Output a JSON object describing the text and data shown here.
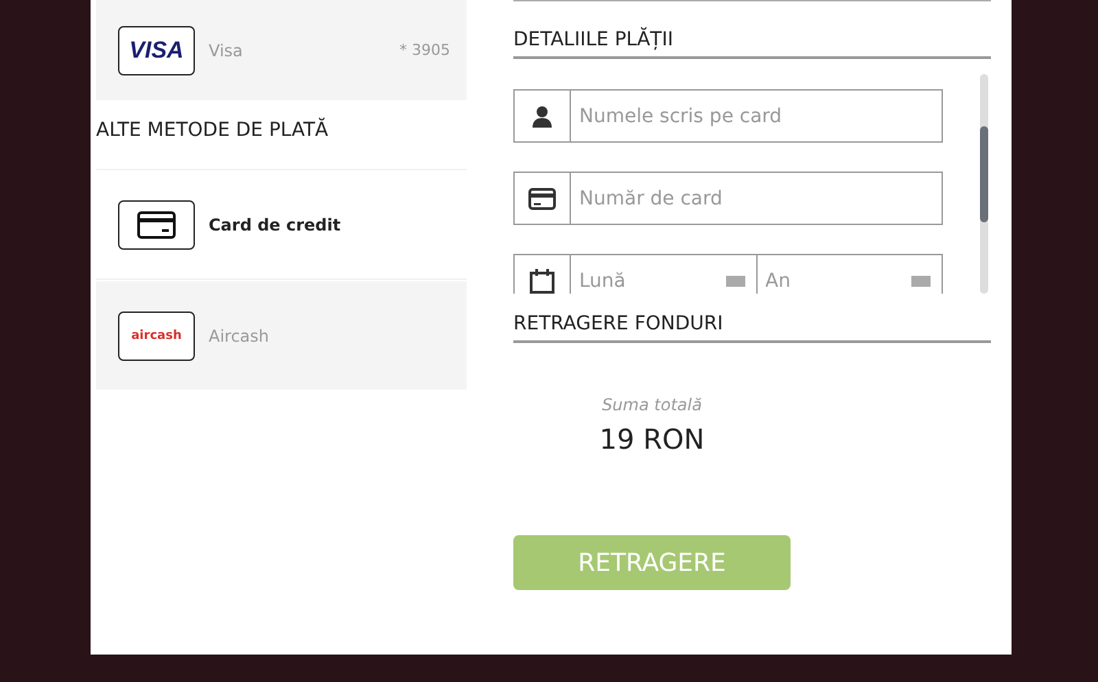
{
  "saved_methods": [
    {
      "kind": "visa",
      "logo_text": "VISA",
      "name": "Visa",
      "masked_number": "* 3905",
      "selected": false
    }
  ],
  "other_methods": {
    "title": "ALTE METODE DE PLATĂ",
    "items": [
      {
        "kind": "card",
        "name": "Card de credit",
        "selected": true
      },
      {
        "kind": "aircash",
        "name": "Aircash",
        "logo_text": "aircash",
        "selected": false
      }
    ]
  },
  "payment_details": {
    "title": "DETALIILE PLĂȚII",
    "fields": [
      {
        "kind": "person",
        "placeholder": "Numele scris pe card"
      },
      {
        "kind": "card",
        "placeholder": "Număr de card"
      }
    ],
    "expiry": {
      "month_placeholder": "Lună",
      "year_placeholder": "An"
    }
  },
  "withdrawal": {
    "title": "RETRAGERE FONDURI",
    "total_label": "Suma totală",
    "total_value": "19 RON",
    "button": "RETRAGERE"
  }
}
